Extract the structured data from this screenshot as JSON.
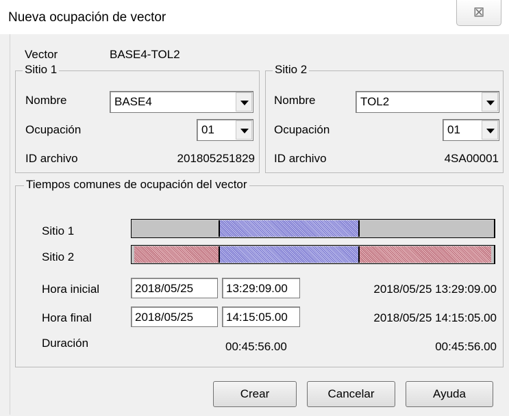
{
  "window": {
    "title": "Nueva ocupación de vector",
    "close_glyph": "⊠"
  },
  "vector": {
    "label": "Vector",
    "value": "BASE4-TOL2"
  },
  "sitio1": {
    "group_label": "Sitio 1",
    "nombre_label": "Nombre",
    "nombre_value": "BASE4",
    "ocupacion_label": "Ocupación",
    "ocupacion_value": "01",
    "id_label": "ID archivo",
    "id_value": "201805251829"
  },
  "sitio2": {
    "group_label": "Sitio 2",
    "nombre_label": "Nombre",
    "nombre_value": "TOL2",
    "ocupacion_label": "Ocupación",
    "ocupacion_value": "01",
    "id_label": "ID archivo",
    "id_value": "4SA00001"
  },
  "common": {
    "group_label": "Tiempos comunes de ocupación del vector",
    "sitio1_label": "Sitio 1",
    "sitio2_label": "Sitio 2",
    "hora_inicial_label": "Hora inicial",
    "hora_inicial_date": "2018/05/25",
    "hora_inicial_time": "13:29:09.00",
    "hora_inicial_full": "2018/05/25 13:29:09.00",
    "hora_final_label": "Hora final",
    "hora_final_date": "2018/05/25",
    "hora_final_time": "14:15:05.00",
    "hora_final_full": "2018/05/25 14:15:05.00",
    "duracion_label": "Duración",
    "duracion_value": "00:45:56.00",
    "duracion_value_right": "00:45:56.00"
  },
  "bar_colors": {
    "background": "#c4c4c4",
    "common_span": "#6a66c9",
    "site2_only": "#b25c6a"
  },
  "buttons": {
    "crear": "Crear",
    "cancelar": "Cancelar",
    "ayuda": "Ayuda"
  }
}
